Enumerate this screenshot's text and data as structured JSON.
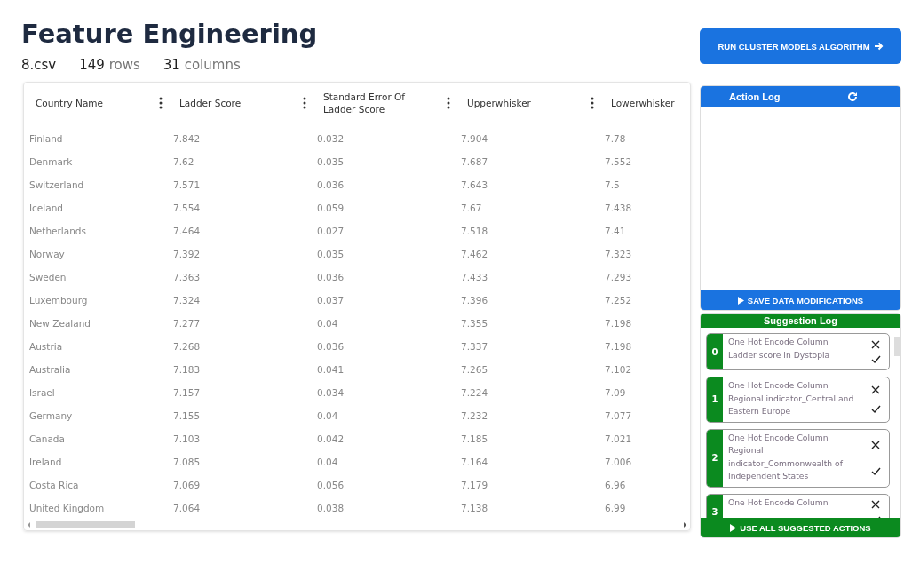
{
  "page": {
    "title": "Feature Engineering",
    "file": "8.csv",
    "rows_count": "149",
    "rows_label": "rows",
    "columns_count": "31",
    "columns_label": "columns"
  },
  "table": {
    "columns": [
      {
        "label": "Country Name",
        "menu": true
      },
      {
        "label": "Ladder Score",
        "menu": true
      },
      {
        "label": "Standard Error Of Ladder Score",
        "menu": true
      },
      {
        "label": "Upperwhisker",
        "menu": true
      },
      {
        "label": "Lowerwhisker",
        "menu": false
      }
    ],
    "rows": [
      [
        "Finland",
        "7.842",
        "0.032",
        "7.904",
        "7.78"
      ],
      [
        "Denmark",
        "7.62",
        "0.035",
        "7.687",
        "7.552"
      ],
      [
        "Switzerland",
        "7.571",
        "0.036",
        "7.643",
        "7.5"
      ],
      [
        "Iceland",
        "7.554",
        "0.059",
        "7.67",
        "7.438"
      ],
      [
        "Netherlands",
        "7.464",
        "0.027",
        "7.518",
        "7.41"
      ],
      [
        "Norway",
        "7.392",
        "0.035",
        "7.462",
        "7.323"
      ],
      [
        "Sweden",
        "7.363",
        "0.036",
        "7.433",
        "7.293"
      ],
      [
        "Luxembourg",
        "7.324",
        "0.037",
        "7.396",
        "7.252"
      ],
      [
        "New Zealand",
        "7.277",
        "0.04",
        "7.355",
        "7.198"
      ],
      [
        "Austria",
        "7.268",
        "0.036",
        "7.337",
        "7.198"
      ],
      [
        "Australia",
        "7.183",
        "0.041",
        "7.265",
        "7.102"
      ],
      [
        "Israel",
        "7.157",
        "0.034",
        "7.224",
        "7.09"
      ],
      [
        "Germany",
        "7.155",
        "0.04",
        "7.232",
        "7.077"
      ],
      [
        "Canada",
        "7.103",
        "0.042",
        "7.185",
        "7.021"
      ],
      [
        "Ireland",
        "7.085",
        "0.04",
        "7.164",
        "7.006"
      ],
      [
        "Costa Rica",
        "7.069",
        "0.056",
        "7.179",
        "6.96"
      ],
      [
        "United Kingdom",
        "7.064",
        "0.038",
        "7.138",
        "6.99"
      ]
    ]
  },
  "run_button": "RUN CLUSTER MODELS ALGORITHM",
  "action_log": {
    "title": "Action Log",
    "save_button": "SAVE DATA MODIFICATIONS"
  },
  "suggestion_log": {
    "title": "Suggestion Log",
    "use_all_button": "USE ALL SUGGESTED ACTIONS",
    "items": [
      {
        "index": "0",
        "text": "One Hot Encode Column Ladder score in Dystopia"
      },
      {
        "index": "1",
        "text": "One Hot Encode Column Regional indicator_Central and Eastern Europe"
      },
      {
        "index": "2",
        "text": "One Hot Encode Column Regional indicator_Commonwealth of Independent States"
      },
      {
        "index": "3",
        "text": "One Hot Encode Column"
      }
    ]
  }
}
